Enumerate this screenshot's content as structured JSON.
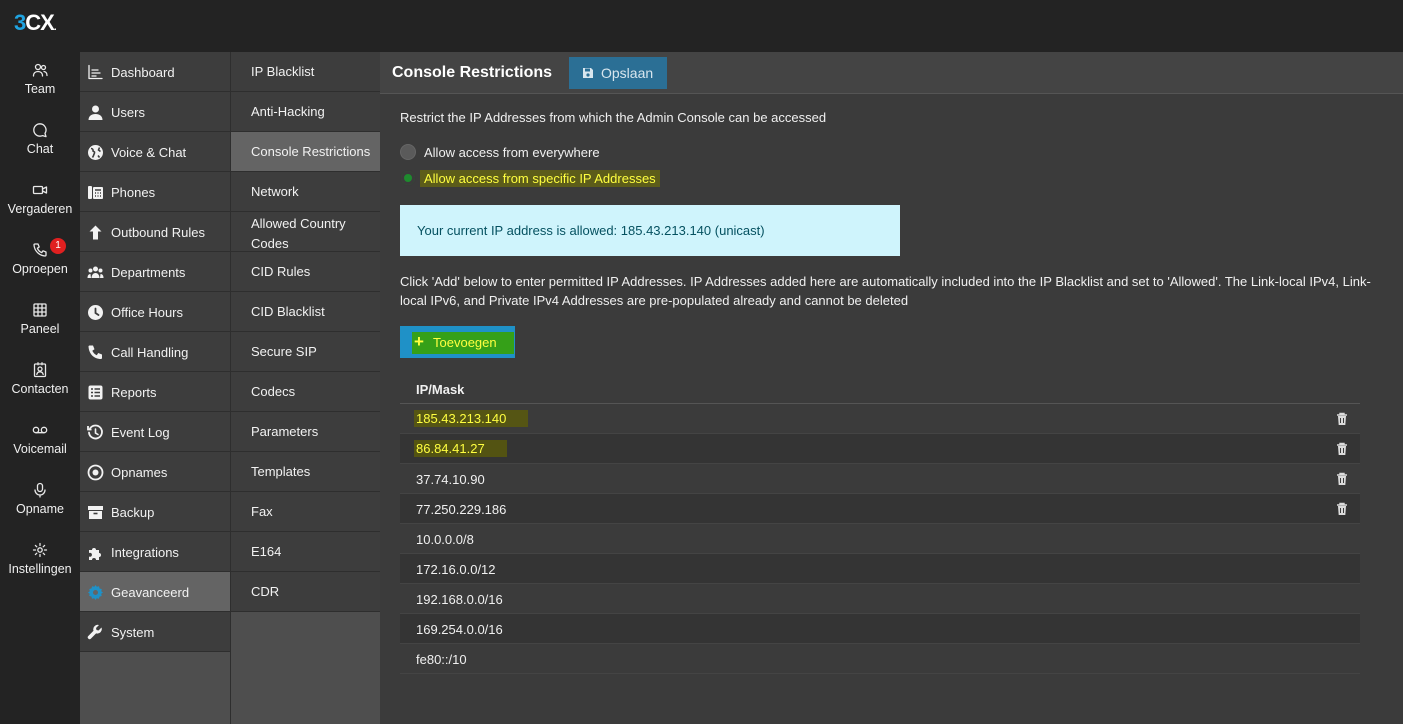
{
  "app": {
    "logo_digit": "3",
    "logo_letters": "CX",
    "logo_dot": "."
  },
  "rail": [
    {
      "label": "Team",
      "icon": "team-icon"
    },
    {
      "label": "Chat",
      "icon": "chat-icon"
    },
    {
      "label": "Vergaderen",
      "icon": "video-icon"
    },
    {
      "label": "Oproepen",
      "icon": "phone-icon",
      "badge": "1"
    },
    {
      "label": "Paneel",
      "icon": "grid-icon"
    },
    {
      "label": "Contacten",
      "icon": "contact-card-icon"
    },
    {
      "label": "Voicemail",
      "icon": "voicemail-icon"
    },
    {
      "label": "Opname",
      "icon": "microphone-icon"
    },
    {
      "label": "Instellingen",
      "icon": "gear-icon"
    }
  ],
  "nav1": [
    {
      "label": "Dashboard",
      "icon": "chart-icon"
    },
    {
      "label": "Users",
      "icon": "user-icon"
    },
    {
      "label": "Voice & Chat",
      "icon": "globe-icon"
    },
    {
      "label": "Phones",
      "icon": "phones-icon"
    },
    {
      "label": "Outbound Rules",
      "icon": "arrow-up-icon"
    },
    {
      "label": "Departments",
      "icon": "departments-icon"
    },
    {
      "label": "Office Hours",
      "icon": "clock-icon"
    },
    {
      "label": "Call Handling",
      "icon": "handset-icon"
    },
    {
      "label": "Reports",
      "icon": "reports-icon"
    },
    {
      "label": "Event Log",
      "icon": "history-icon"
    },
    {
      "label": "Opnames",
      "icon": "record-icon"
    },
    {
      "label": "Backup",
      "icon": "archive-icon"
    },
    {
      "label": "Integrations",
      "icon": "puzzle-icon"
    },
    {
      "label": "Geavanceerd",
      "icon": "cog-icon",
      "active": true
    },
    {
      "label": "System",
      "icon": "wrench-icon"
    }
  ],
  "nav2": [
    {
      "label": "IP Blacklist"
    },
    {
      "label": "Anti-Hacking"
    },
    {
      "label": "Console Restrictions",
      "active": true
    },
    {
      "label": "Network"
    },
    {
      "label": "Allowed Country Codes",
      "twoline": true
    },
    {
      "label": "CID Rules"
    },
    {
      "label": "CID Blacklist"
    },
    {
      "label": "Secure SIP"
    },
    {
      "label": "Codecs"
    },
    {
      "label": "Parameters"
    },
    {
      "label": "Templates"
    },
    {
      "label": "Fax"
    },
    {
      "label": "E164"
    },
    {
      "label": "CDR"
    }
  ],
  "main": {
    "title": "Console Restrictions",
    "save_label": "Opslaan",
    "description": "Restrict the IP Addresses from which the Admin Console can be accessed",
    "radio_everywhere": "Allow access from everywhere",
    "radio_specific": "Allow access from specific IP Addresses",
    "info": "Your current IP address is allowed: 185.43.213.140 (unicast)",
    "hint": "Click 'Add' below to enter permitted IP Addresses. IP Addresses added here are automatically included into the IP Blacklist and set to 'Allowed'. The Link-local IPv4, Link-local IPv6, and Private IPv4 Addresses are pre-populated already and cannot be deleted",
    "add_label": "Toevoegen",
    "add_icon": "+",
    "table_header": "IP/Mask",
    "rows": [
      {
        "ip": "185.43.213.140",
        "deletable": true,
        "highlight": true
      },
      {
        "ip": "86.84.41.27",
        "deletable": true,
        "highlight": true
      },
      {
        "ip": "37.74.10.90",
        "deletable": true
      },
      {
        "ip": "77.250.229.186",
        "deletable": true
      },
      {
        "ip": "10.0.0.0/8"
      },
      {
        "ip": "172.16.0.0/12"
      },
      {
        "ip": "192.168.0.0/16"
      },
      {
        "ip": "169.254.0.0/16"
      },
      {
        "ip": "fe80::/10"
      }
    ]
  }
}
